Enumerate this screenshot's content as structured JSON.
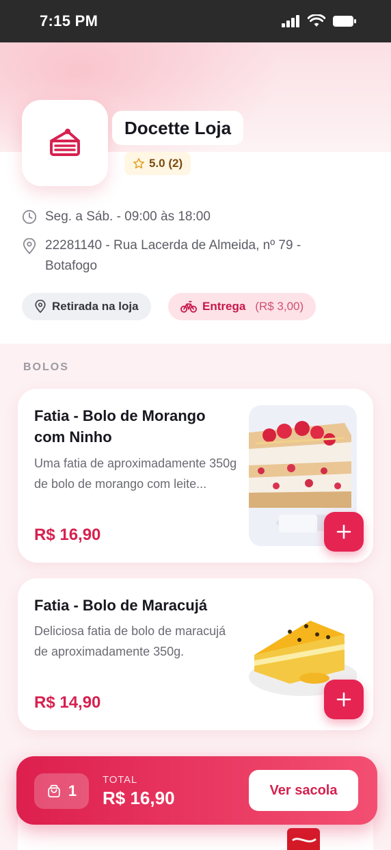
{
  "status_bar": {
    "time": "7:15 PM"
  },
  "store": {
    "name": "Docette Loja",
    "rating": "5.0 (2)",
    "hours": "Seg. a Sáb. - 09:00 às 18:00",
    "address_line1": "22281140 - Rua Lacerda de Almeida, nº 79 -",
    "address_line2": "Botafogo",
    "pickup_label": "Retirada na loja",
    "delivery_label": "Entrega",
    "delivery_fee": "(R$ 3,00)"
  },
  "section": {
    "title": "BOLOS"
  },
  "products": [
    {
      "title": "Fatia - Bolo de Morango com Ninho",
      "description": "Uma fatia de aproximadamente 350g de bolo de morango com leite...",
      "price": "R$ 16,90"
    },
    {
      "title": "Fatia - Bolo de Maracujá",
      "description": "Deliciosa fatia de bolo de maracujá de aproximadamente 350g.",
      "price": "R$ 14,90"
    }
  ],
  "cart": {
    "count": "1",
    "total_label": "TOTAL",
    "total_value": "R$ 16,90",
    "button_label": "Ver sacola"
  },
  "colors": {
    "accent": "#e52452",
    "price": "#d6214f"
  }
}
